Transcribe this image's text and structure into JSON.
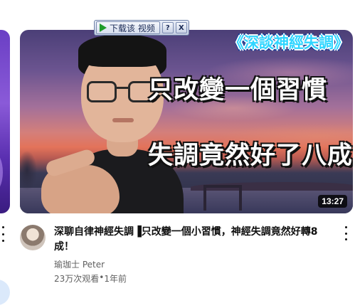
{
  "video": {
    "title": "深聊自律神經失調▐只改變一個小習慣，神經失調竟然好轉8成！",
    "channel": "瑜珈士 Peter",
    "views": "23万次观看",
    "separator": "•",
    "age": "1年前",
    "duration": "13:27",
    "thumbnail": {
      "subtitle": "《深談神經失調》",
      "line1": "只改變一個習慣",
      "line2": "失調竟然好了八成！"
    }
  },
  "download_bar": {
    "label": "下载该 视频",
    "help": "?",
    "close": "X"
  },
  "colors": {
    "subtitle_text": "#2fd5ff",
    "duration_bg": "#000000cc",
    "download_icon": "#1f9c2b",
    "meta_text": "#606060"
  },
  "icons": [
    "play-icon",
    "help-icon",
    "close-icon",
    "more-vert-icon"
  ]
}
